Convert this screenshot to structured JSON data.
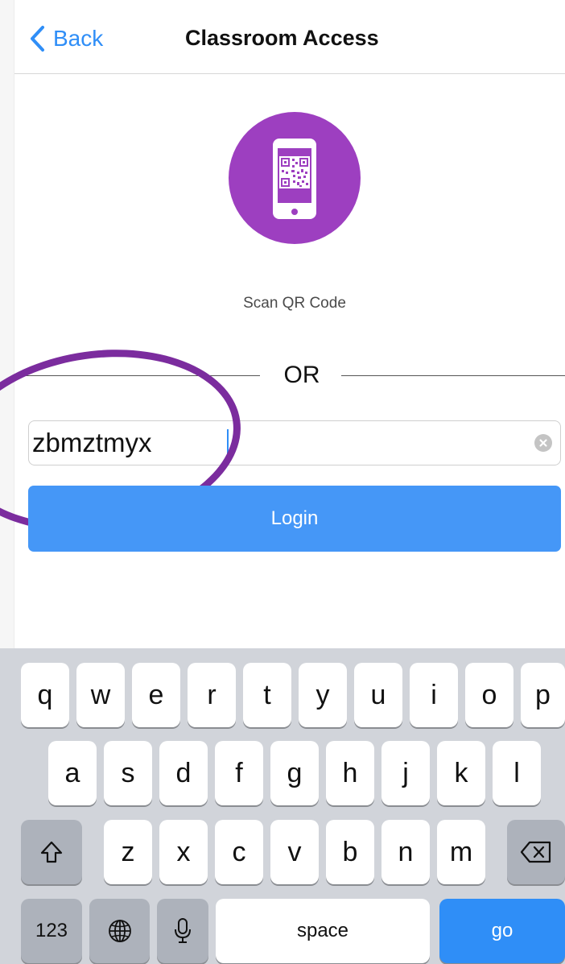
{
  "nav": {
    "back_label": "Back",
    "title": "Classroom Access"
  },
  "scan": {
    "label": "Scan QR Code"
  },
  "divider": {
    "text": "OR"
  },
  "code_input": {
    "value": "zbmztmyx"
  },
  "login": {
    "label": "Login"
  },
  "keyboard": {
    "row1": [
      "q",
      "w",
      "e",
      "r",
      "t",
      "y",
      "u",
      "i",
      "o",
      "p"
    ],
    "row2": [
      "a",
      "s",
      "d",
      "f",
      "g",
      "h",
      "j",
      "k",
      "l"
    ],
    "row3": [
      "z",
      "x",
      "c",
      "v",
      "b",
      "n",
      "m"
    ],
    "numbers_label": "123",
    "space_label": "space",
    "go_label": "go"
  },
  "colors": {
    "accent": "#2f8ef7",
    "login_button": "#4597f7",
    "qr_circle": "#9d3fc0",
    "annotation": "#7b2c9e"
  }
}
